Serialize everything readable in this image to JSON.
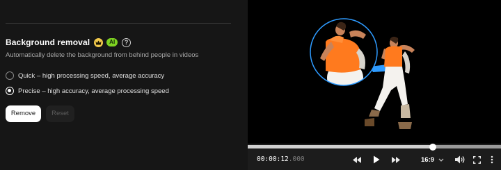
{
  "panel": {
    "title": "Background removal",
    "ai_badge": "AI",
    "help_glyph": "?",
    "description": "Automatically delete the background from behind people in videos",
    "options": [
      {
        "label": "Quick – high processing speed, average accuracy",
        "selected": false
      },
      {
        "label": "Precise – high accuracy, average processing speed",
        "selected": true
      }
    ],
    "remove_label": "Remove",
    "reset_label": "Reset"
  },
  "player": {
    "time_main": "00:00:12",
    "time_ms": ".000",
    "progress": 0.73,
    "aspect_ratio": "16:9"
  },
  "colors": {
    "accent_blue": "#2e9bff",
    "ai_badge": "#7ed321",
    "crown": "#f2c94c",
    "shirt_orange": "#ff7a1e"
  }
}
